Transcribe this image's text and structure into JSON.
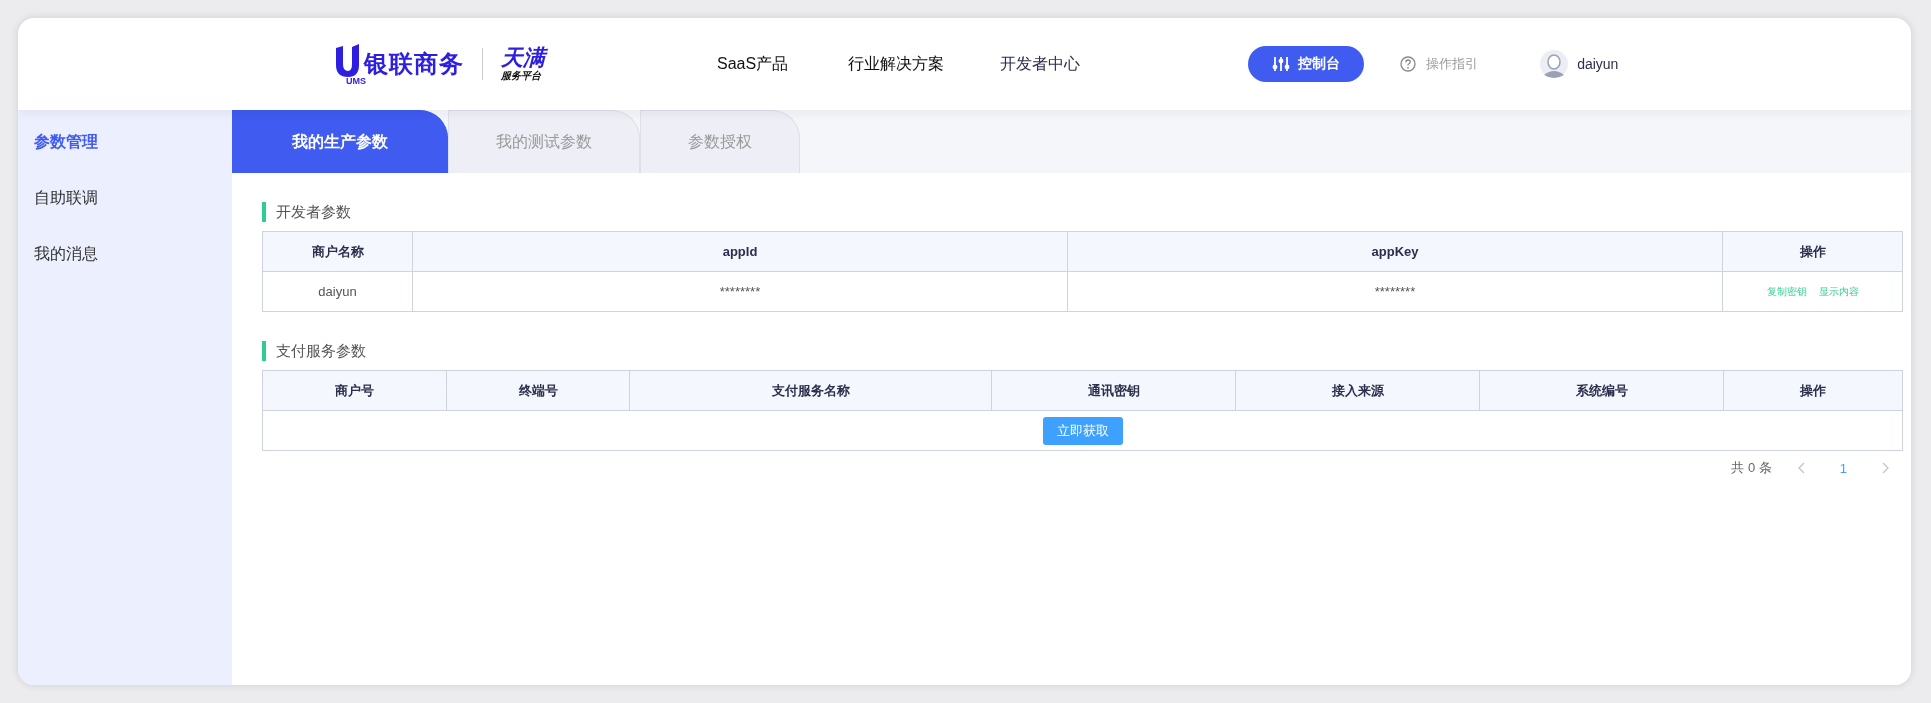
{
  "header": {
    "logo": {
      "brand": "银联商务",
      "brand_sub": "UMS",
      "platform": "天满",
      "platform_sub": "服务平台"
    },
    "nav": [
      {
        "label": "SaaS产品",
        "selected": false
      },
      {
        "label": "行业解决方案",
        "selected": false
      },
      {
        "label": "开发者中心",
        "selected": true
      }
    ],
    "console_button": "控制台",
    "guide": "操作指引",
    "user": "daiyun"
  },
  "sidebar": {
    "items": [
      {
        "label": "参数管理",
        "selected": true
      },
      {
        "label": "自助联调",
        "selected": false
      },
      {
        "label": "我的消息",
        "selected": false
      }
    ]
  },
  "tabs": [
    {
      "label": "我的生产参数",
      "selected": true
    },
    {
      "label": "我的测试参数",
      "selected": false
    },
    {
      "label": "参数授权",
      "selected": false
    }
  ],
  "developer_params": {
    "title": "开发者参数",
    "columns": [
      "商户名称",
      "appId",
      "appKey",
      "操作"
    ],
    "rows": [
      {
        "cells": [
          "daiyun",
          "********",
          "********"
        ],
        "actions": [
          "复制密钥",
          "显示内容"
        ]
      }
    ]
  },
  "payment_params": {
    "title": "支付服务参数",
    "columns": [
      "商户号",
      "终端号",
      "支付服务名称",
      "通讯密钥",
      "接入来源",
      "系统编号",
      "操作"
    ],
    "empty_button": "立即获取"
  },
  "pagination": {
    "total": "共 0 条",
    "pages": [
      {
        "label": "1",
        "selected": true
      }
    ]
  }
}
